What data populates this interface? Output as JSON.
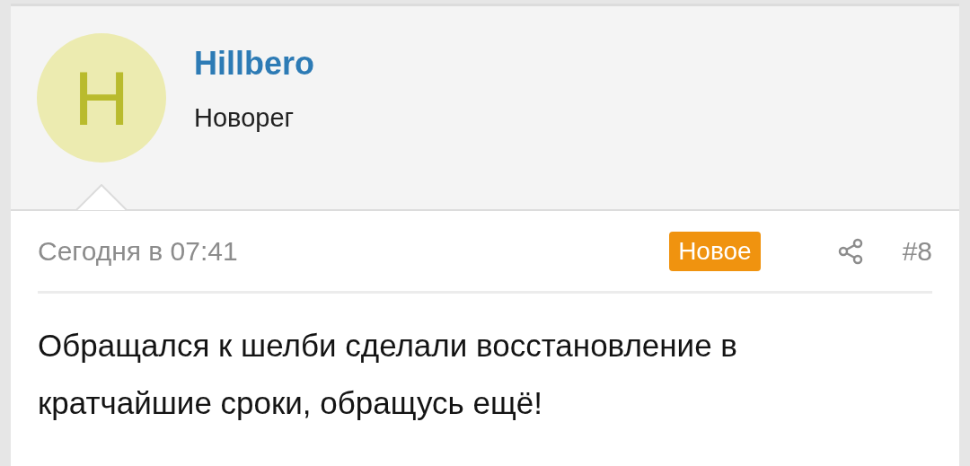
{
  "user": {
    "avatar_letter": "H",
    "name": "Hillbero",
    "title": "Новорег"
  },
  "post": {
    "date": "Сегодня в 07:41",
    "badge": "Новое",
    "number": "#8",
    "message": "Обращался к шелби сделали восстановление в кратчайшие сроки, обращусь ещё!"
  }
}
